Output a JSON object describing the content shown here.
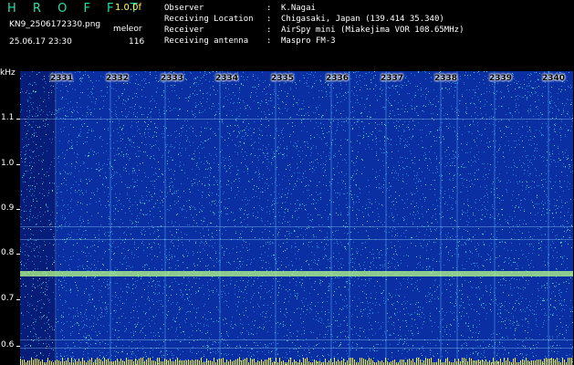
{
  "header": {
    "app_title": "H R O F F T",
    "version": "1.0.0f",
    "filename": "KN9_2506172330.png",
    "meleor_label": "meleor",
    "datetime": "25.06.17 23:30",
    "count": "116"
  },
  "info": {
    "rows": [
      {
        "label": "Observer",
        "sep": ":",
        "value": "K.Nagai"
      },
      {
        "label": "Receiving Location",
        "sep": ":",
        "value": "Chigasaki, Japan (139.414 35.340)"
      },
      {
        "label": "Receiver",
        "sep": ":",
        "value": "AirSpy mini (Miakejima VOR 108.65MHz)"
      },
      {
        "label": "Receiving antenna",
        "sep": ":",
        "value": "Maspro FM-3"
      }
    ]
  },
  "axis": {
    "y_unit": "kHz",
    "y_ticks": [
      "1.1",
      "1.0",
      "0.9",
      "0.8",
      "0.7",
      "0.6"
    ],
    "x_ticks": [
      "2331",
      "2332",
      "2333",
      "2334",
      "2335",
      "2336",
      "2337",
      "2338",
      "2339",
      "2340"
    ]
  },
  "colors": {
    "background": "#0a2fa3",
    "noise_light": "#3fc0ff",
    "noise_green": "#7dffb0",
    "trace": "#b8ff8a",
    "title": "#22e0a8",
    "version": "#ffff55"
  }
}
